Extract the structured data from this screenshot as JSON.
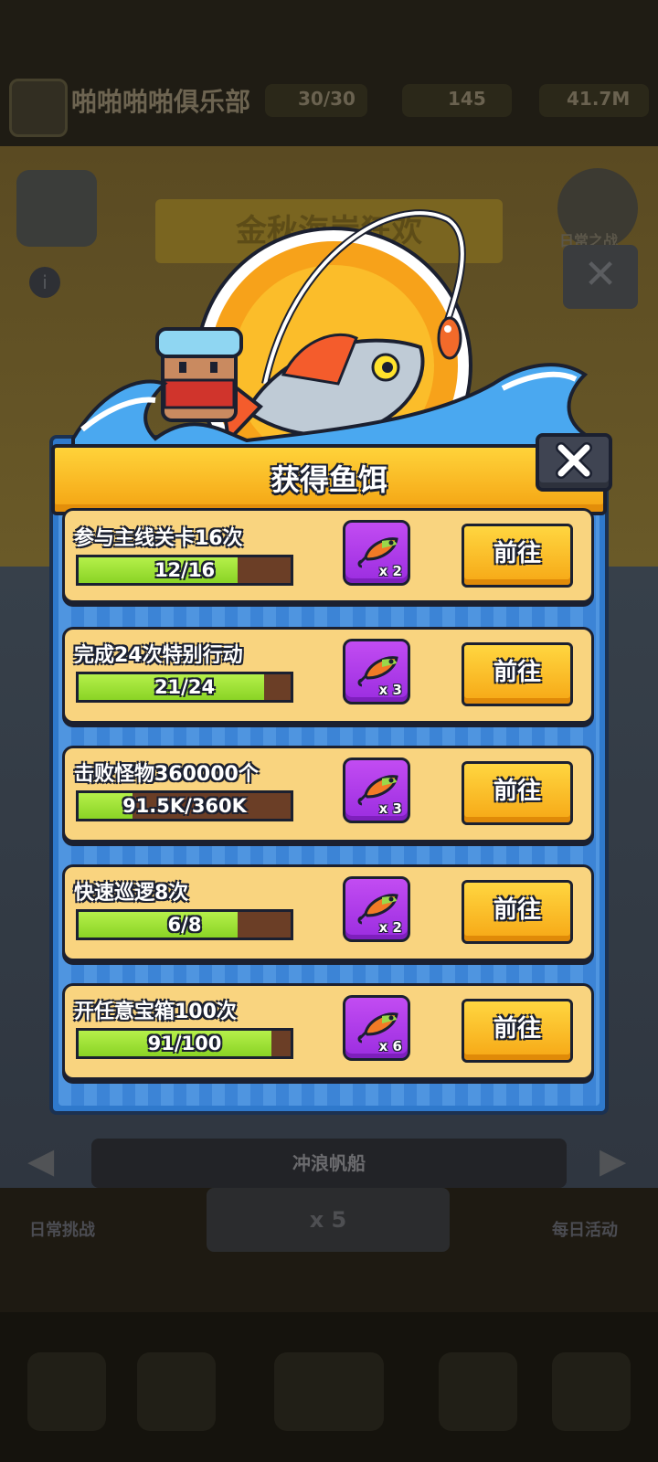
{
  "background": {
    "guild_name": "啪啪啪啪俱乐部",
    "stats": [
      "30/30",
      "145",
      "41.7M"
    ],
    "event_banner": "金秋海岸狂欢",
    "right_badge_label": "日常之战",
    "ship_name": "冲浪帆船",
    "cost_text": "x 5",
    "left_label": "日常挑战",
    "right_label": "每日活动"
  },
  "dialog": {
    "title": "获得鱼饵",
    "tasks": [
      {
        "title": "参与主线关卡16次",
        "progress_text": "12/16",
        "progress": 0.75,
        "reward_count": "x 2",
        "button": "前往"
      },
      {
        "title": "完成24次特别行动",
        "progress_text": "21/24",
        "progress": 0.875,
        "reward_count": "x 3",
        "button": "前往"
      },
      {
        "title": "击败怪物360000个",
        "progress_text": "91.5K/360K",
        "progress": 0.254,
        "reward_count": "x 3",
        "button": "前往"
      },
      {
        "title": "快速巡逻8次",
        "progress_text": "6/8",
        "progress": 0.75,
        "reward_count": "x 2",
        "button": "前往"
      },
      {
        "title": "开任意宝箱100次",
        "progress_text": "91/100",
        "progress": 0.91,
        "reward_count": "x 6",
        "button": "前往"
      }
    ]
  },
  "colors": {
    "title_bar": "#f4a312",
    "panel_blue": "#2f79cc",
    "card": "#f9d47f",
    "progress_fill": "#8ad425",
    "reward_purple": "#9b2de0",
    "button_yellow": "#f6a715"
  },
  "icons": {
    "close": "close-x-icon",
    "reward": "fish-lure-icon",
    "info": "info-icon"
  }
}
